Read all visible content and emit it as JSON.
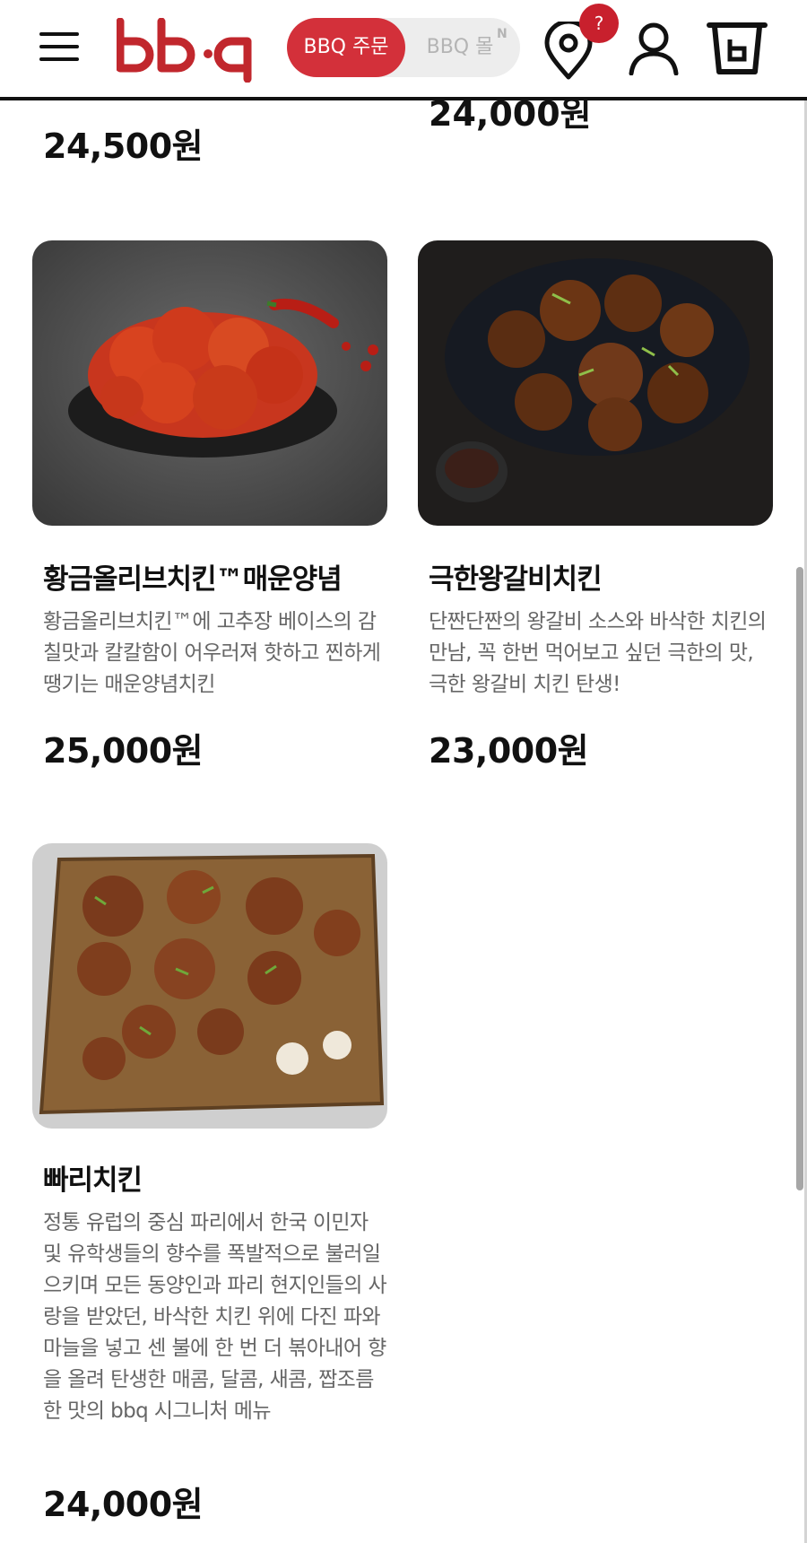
{
  "header": {
    "logo_text": "bb·q",
    "toggle_active_label": "BBQ 주문",
    "toggle_inactive_label": "BBQ 몰",
    "toggle_new_badge": "N",
    "help_badge": "?"
  },
  "partial_top": {
    "left_price": "24,500원",
    "right_price": "24,000원"
  },
  "products": [
    {
      "name": "황금올리브치킨™매운양념",
      "description": "황금올리브치킨™에 고추장 베이스의 감칠맛과 칼칼함이 어우러져 핫하고 찐하게 땡기는 매운양념치킨",
      "price": "25,000원"
    },
    {
      "name": "극한왕갈비치킨",
      "description": "단짠단짠의 왕갈비 소스와 바삭한 치킨의 만남, 꼭 한번 먹어보고 싶던 극한의 맛, 극한 왕갈비 치킨 탄생!",
      "price": "23,000원"
    },
    {
      "name": "빠리치킨",
      "description": "정통 유럽의 중심 파리에서 한국 이민자 및 유학생들의 향수를 폭발적으로 불러일으키며 모든 동양인과 파리 현지인들의 사랑을 받았던, 바삭한 치킨 위에 다진 파와 마늘을 넣고 센 불에 한 번 더 볶아내어 향을 올려 탄생한 매콤, 달콤, 새콤, 짭조름한 맛의 bbq 시그니처 메뉴",
      "price": "24,000원"
    }
  ],
  "colors": {
    "brand_red": "#d3303a",
    "logo_red": "#c1272d",
    "text_dark": "#111111",
    "text_gray": "#666666"
  }
}
